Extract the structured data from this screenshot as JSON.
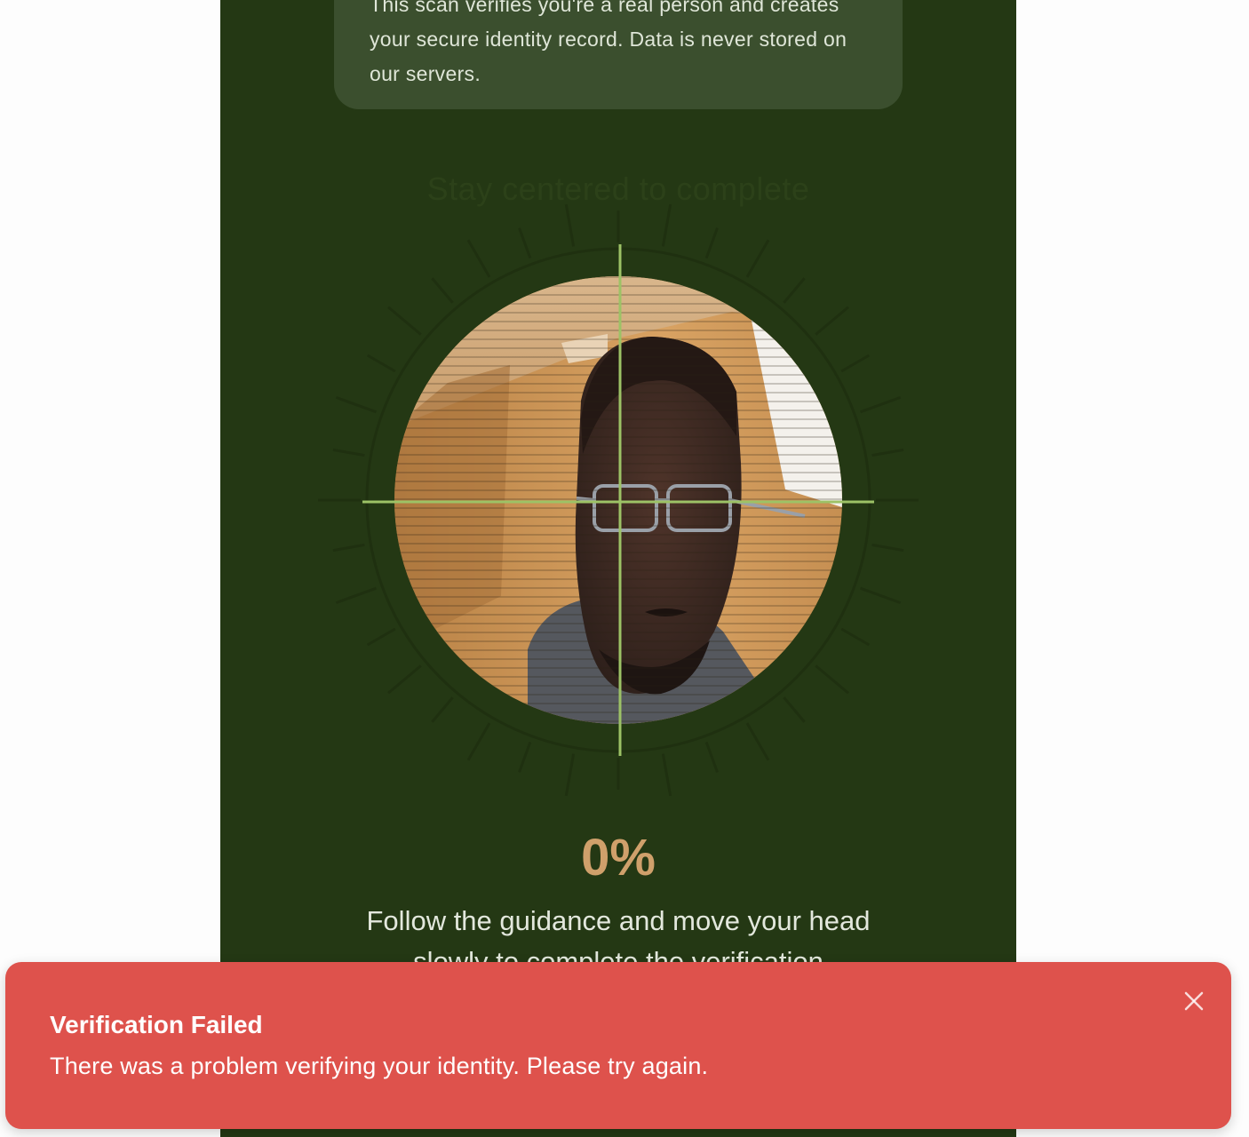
{
  "info_card": {
    "text": "This scan verifies you're a real person and creates your secure identity record. Data is never stored on our servers."
  },
  "scanner": {
    "hint": "Stay centered to complete",
    "progress_percent": 0,
    "progress_label": "0%",
    "guidance": "Follow the guidance and move your head slowly to complete the verification",
    "crosshair_color": "#9dc266",
    "tick_color": "#1f3010"
  },
  "toast": {
    "title": "Verification Failed",
    "description": "There was a problem verifying your identity. Please try again.",
    "close_icon": "close-icon",
    "background": "#de524c"
  },
  "theme": {
    "app_background": "#243814",
    "accent": "#cfa06b"
  }
}
